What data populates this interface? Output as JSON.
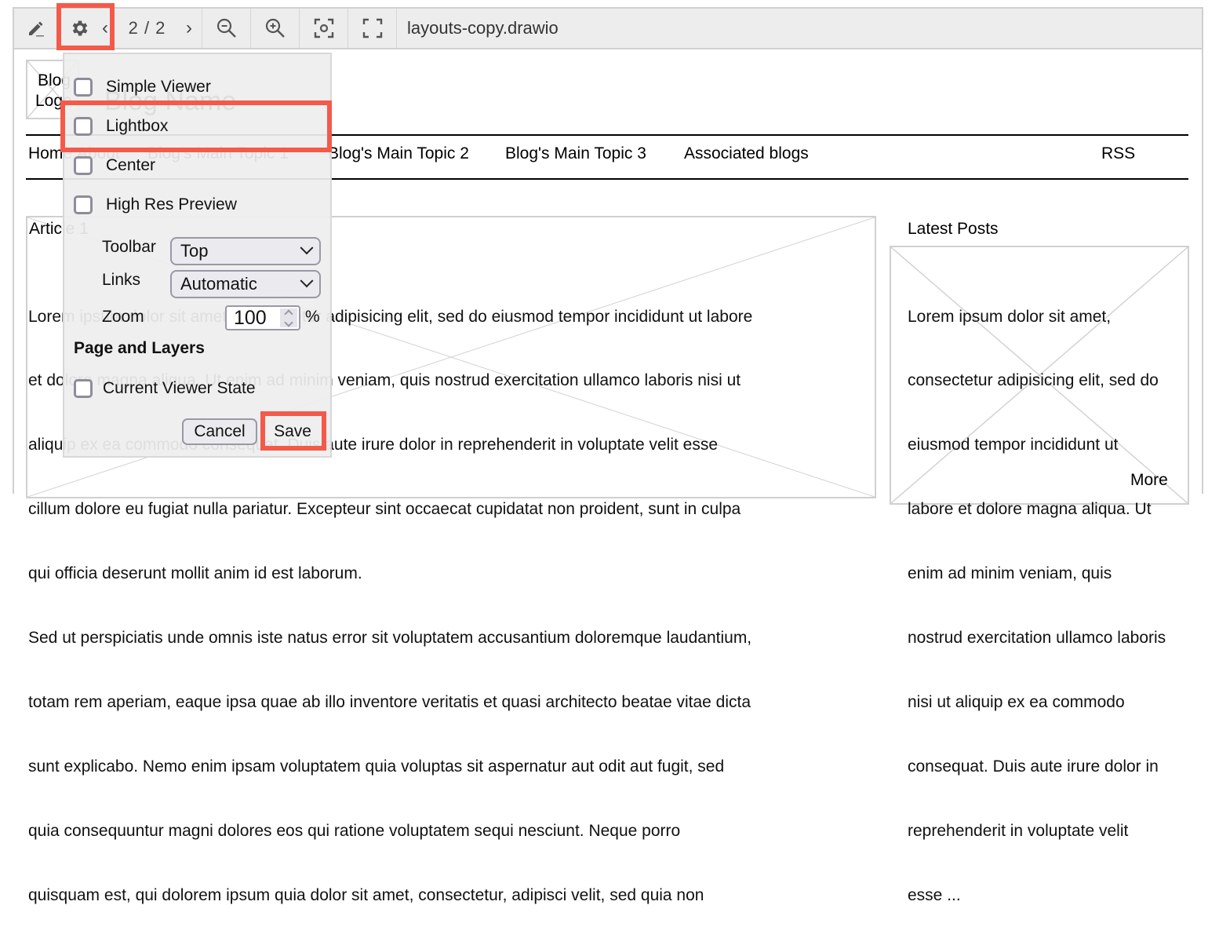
{
  "toolbar": {
    "edit_icon": "pencil-icon",
    "settings_icon": "gear-icon",
    "prev_page_icon": "chevron-left-icon",
    "page_indicator": "2 / 2",
    "next_page_icon": "chevron-right-icon",
    "zoom_out_icon": "zoom-out-icon",
    "zoom_in_icon": "zoom-in-icon",
    "fit_icon": "focus-icon",
    "fullscreen_icon": "fullscreen-icon",
    "file_name": "layouts-copy.drawio"
  },
  "diagram": {
    "logo_text_line1": "Blog",
    "logo_text_line2": "Logo",
    "blog_name": "Blog Name",
    "nav": [
      "Home",
      "About",
      "Blog's Main Topic 1",
      "Blog's Main Topic 2",
      "Blog's Main Topic 3",
      "Associated blogs",
      "RSS"
    ],
    "article_title": "Article 1",
    "article_lines": [
      "Lorem ipsum dolor sit amet, consectetur adipisicing elit, sed do eiusmod tempor incididunt ut labore",
      "et dolore magna aliqua. Ut enim ad minim veniam, quis nostrud exercitation ullamco laboris nisi ut",
      "aliquip ex ea commodo consequat. Duis aute irure dolor in reprehenderit in voluptate velit esse",
      "cillum dolore eu fugiat nulla pariatur. Excepteur sint occaecat cupidatat non proident, sunt in culpa",
      "qui officia deserunt mollit anim id est laborum.",
      "Sed ut perspiciatis unde omnis iste natus error sit voluptatem accusantium doloremque laudantium,",
      "totam rem aperiam, eaque ipsa quae ab illo inventore veritatis et quasi architecto beatae vitae dicta",
      "sunt explicabo. Nemo enim ipsam voluptatem quia voluptas sit aspernatur aut odit aut fugit, sed",
      "quia consequuntur magni dolores eos qui ratione voluptatem sequi nesciunt. Neque porro",
      "quisquam est, qui dolorem ipsum quia dolor sit amet, consectetur, adipisci velit, sed quia non"
    ],
    "latest_posts_title": "Latest Posts",
    "latest_posts_lines": [
      "Lorem ipsum dolor sit amet,",
      "consectetur adipisicing elit, sed do",
      "eiusmod tempor incididunt ut",
      "labore et dolore magna aliqua. Ut",
      "enim ad minim veniam, quis",
      "nostrud exercitation ullamco laboris",
      "nisi ut aliquip ex ea commodo",
      "consequat. Duis aute irure dolor in",
      "reprehenderit in voluptate velit",
      "esse ..."
    ],
    "more_link": "More"
  },
  "settings_popup": {
    "checkboxes": [
      {
        "label": "Simple Viewer",
        "checked": false
      },
      {
        "label": "Lightbox",
        "checked": false
      },
      {
        "label": "Center",
        "checked": false
      },
      {
        "label": "High Res Preview",
        "checked": false
      }
    ],
    "toolbar_label": "Toolbar",
    "toolbar_value": "Top",
    "links_label": "Links",
    "links_value": "Automatic",
    "zoom_label": "Zoom",
    "zoom_value": "100",
    "zoom_unit": "%",
    "section_title": "Page and Layers",
    "current_viewer_state_label": "Current Viewer State",
    "current_viewer_state_checked": false,
    "cancel_label": "Cancel",
    "save_label": "Save"
  },
  "highlight_color": "#f45a4a"
}
